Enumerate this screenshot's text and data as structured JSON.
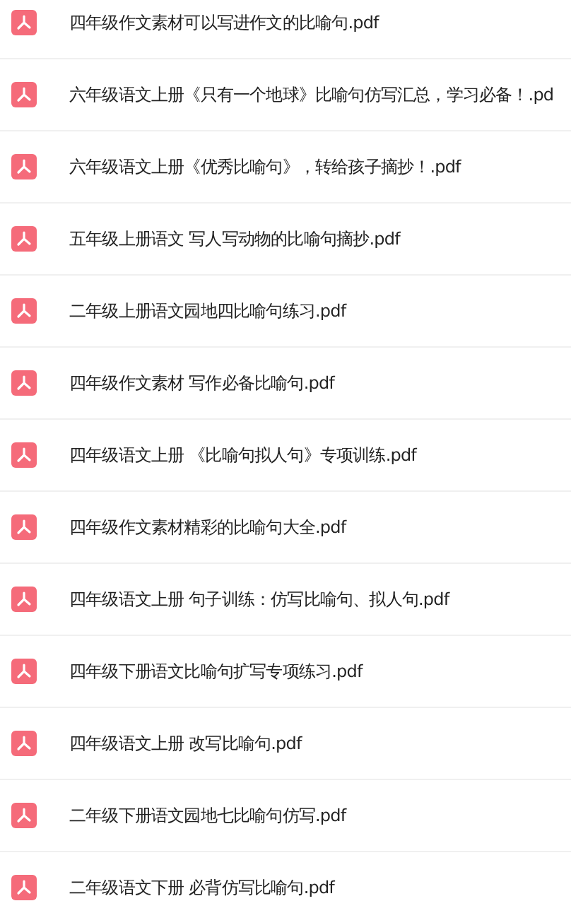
{
  "files": [
    {
      "name": "四年级作文素材可以写进作文的比喻句.pdf"
    },
    {
      "name": "六年级语文上册《只有一个地球》比喻句仿写汇总，学习必备！.pd"
    },
    {
      "name": "六年级语文上册《优秀比喻句》，转给孩子摘抄！.pdf"
    },
    {
      "name": "五年级上册语文 写人写动物的比喻句摘抄.pdf"
    },
    {
      "name": "二年级上册语文园地四比喻句练习.pdf"
    },
    {
      "name": "四年级作文素材 写作必备比喻句.pdf"
    },
    {
      "name": "四年级语文上册 《比喻句拟人句》专项训练.pdf"
    },
    {
      "name": "四年级作文素材精彩的比喻句大全.pdf"
    },
    {
      "name": "四年级语文上册 句子训练：仿写比喻句、拟人句.pdf"
    },
    {
      "name": "四年级下册语文比喻句扩写专项练习.pdf"
    },
    {
      "name": "四年级语文上册 改写比喻句.pdf"
    },
    {
      "name": "二年级下册语文园地七比喻句仿写.pdf"
    },
    {
      "name": "二年级语文下册 必背仿写比喻句.pdf"
    }
  ]
}
